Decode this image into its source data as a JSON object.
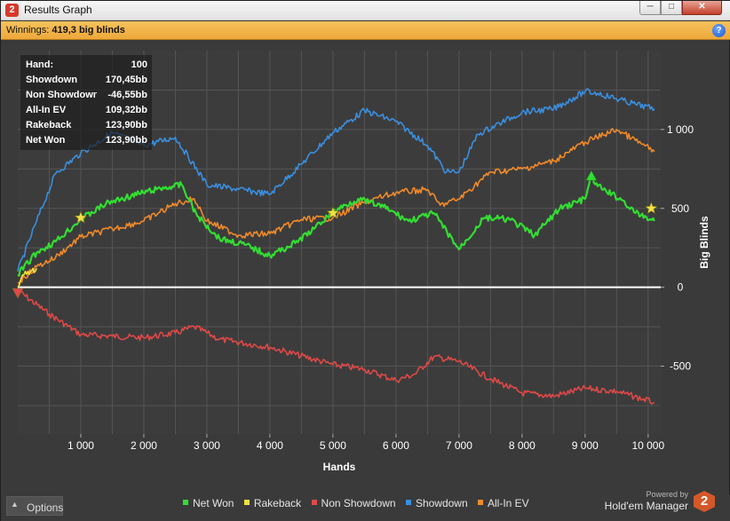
{
  "window": {
    "title": "Results Graph",
    "minimize_glyph": "─",
    "maximize_glyph": "□",
    "close_glyph": "✕"
  },
  "app_icon_glyph": "2",
  "winnings": {
    "label": "Winnings:",
    "value": "419,3 big blinds"
  },
  "help_glyph": "?",
  "stats": {
    "rows": [
      {
        "key": "Hand:",
        "value": "100"
      },
      {
        "key": "Showdown",
        "value": "170,45bb"
      },
      {
        "key": "Non Showdown",
        "value": "-46,55bb"
      },
      {
        "key": "All-In EV",
        "value": "109,32bb"
      },
      {
        "key": "Rakeback",
        "value": "123,90bb"
      },
      {
        "key": "Net Won",
        "value": "123,90bb"
      }
    ]
  },
  "options_label": "Options",
  "options_caret": "▲",
  "brand": {
    "powered_by": "Powered by",
    "name": "Hold'em Manager",
    "logo_glyph": "2"
  },
  "colors": {
    "net_won": "#33dd33",
    "rakeback": "#f0e040",
    "non_showdown": "#e04848",
    "showdown": "#3a8fe0",
    "all_in_ev": "#f08a2a",
    "background": "#3a3a3a",
    "grid": "#555555"
  },
  "chart_data": {
    "type": "line",
    "xlabel": "Hands",
    "ylabel": "Big Blinds",
    "xlim": [
      0,
      10200
    ],
    "ylim": [
      -930,
      1500
    ],
    "xticks": [
      1000,
      2000,
      3000,
      4000,
      5000,
      6000,
      7000,
      8000,
      9000,
      10000
    ],
    "xtick_labels": [
      "1 000",
      "2 000",
      "3 000",
      "4 000",
      "5 000",
      "6 000",
      "7 000",
      "8 000",
      "9 000",
      "10 000"
    ],
    "yticks": [
      -500,
      0,
      500,
      1000
    ],
    "ytick_labels": [
      "-500",
      "0",
      "500",
      "1 000"
    ],
    "grid": true,
    "legend": "bottom",
    "series": [
      {
        "name": "Net Won",
        "color_key": "net_won",
        "x": [
          0,
          300,
          600,
          1000,
          1400,
          1800,
          2200,
          2600,
          2850,
          3200,
          3600,
          4000,
          4400,
          4700,
          5000,
          5400,
          5800,
          6200,
          6600,
          7000,
          7400,
          7800,
          8200,
          8600,
          9000,
          9100,
          9200,
          9600,
          9800,
          10100
        ],
        "y": [
          80,
          220,
          290,
          430,
          530,
          580,
          620,
          650,
          450,
          310,
          270,
          200,
          280,
          370,
          480,
          560,
          510,
          420,
          470,
          240,
          440,
          430,
          330,
          500,
          560,
          700,
          640,
          550,
          470,
          420
        ]
      },
      {
        "name": "Rakeback",
        "color_key": "rakeback",
        "x": [
          0,
          50,
          100,
          200,
          300
        ],
        "y": [
          0,
          50,
          80,
          100,
          120
        ]
      },
      {
        "name": "Non Showdown",
        "color_key": "non_showdown",
        "x": [
          0,
          500,
          1000,
          1500,
          2000,
          2500,
          2800,
          3200,
          4000,
          5000,
          5500,
          6000,
          6300,
          6600,
          7000,
          7500,
          8000,
          8500,
          9000,
          9500,
          10100
        ],
        "y": [
          -20,
          -170,
          -300,
          -310,
          -320,
          -290,
          -250,
          -330,
          -380,
          -490,
          -520,
          -590,
          -550,
          -440,
          -470,
          -580,
          -670,
          -690,
          -640,
          -660,
          -730
        ]
      },
      {
        "name": "Showdown",
        "color_key": "showdown",
        "x": [
          0,
          300,
          600,
          1000,
          1500,
          2000,
          2500,
          3000,
          3500,
          4000,
          4500,
          5000,
          5500,
          6000,
          6500,
          6800,
          7000,
          7300,
          8000,
          8500,
          9000,
          9200,
          9800,
          10100
        ],
        "y": [
          100,
          420,
          720,
          850,
          980,
          900,
          950,
          650,
          620,
          590,
          780,
          980,
          1120,
          1050,
          900,
          730,
          730,
          970,
          1110,
          1130,
          1240,
          1230,
          1160,
          1130
        ]
      },
      {
        "name": "All-In EV",
        "color_key": "all_in_ev",
        "x": [
          0,
          300,
          600,
          1000,
          1500,
          2000,
          2500,
          2800,
          3000,
          3500,
          4000,
          4500,
          5000,
          5500,
          6000,
          6500,
          6700,
          7000,
          7500,
          8000,
          8500,
          9000,
          9500,
          10100
        ],
        "y": [
          30,
          130,
          190,
          320,
          370,
          420,
          530,
          560,
          420,
          330,
          340,
          430,
          440,
          540,
          600,
          620,
          520,
          560,
          730,
          750,
          800,
          920,
          1000,
          860
        ]
      }
    ],
    "markers": [
      {
        "type": "star",
        "color_key": "rakeback",
        "x": 1000,
        "y": 440
      },
      {
        "type": "star",
        "color_key": "rakeback",
        "x": 5000,
        "y": 470
      },
      {
        "type": "star",
        "color_key": "rakeback",
        "x": 10050,
        "y": 500
      },
      {
        "type": "up-triangle",
        "color_key": "net_won",
        "x": 9100,
        "y": 700
      },
      {
        "type": "down-triangle",
        "color_key": "non_showdown",
        "x": 0,
        "y": -30
      }
    ]
  }
}
